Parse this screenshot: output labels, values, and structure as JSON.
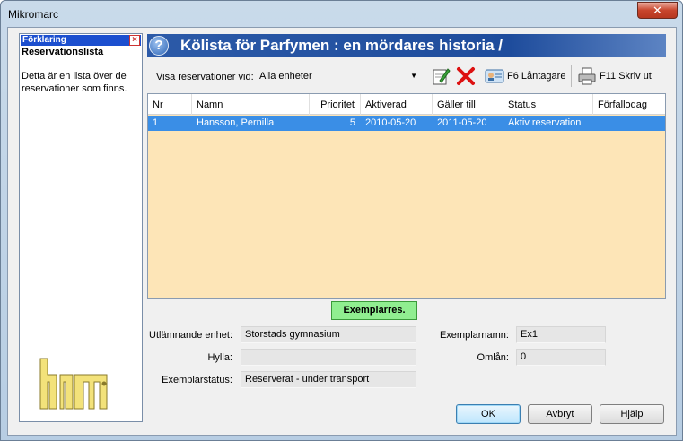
{
  "window": {
    "title": "Mikromarc",
    "close_label": "✕"
  },
  "help_panel": {
    "header": "Förklaring",
    "title": "Reservationslista",
    "text": "Detta är en lista över de reservationer som finns."
  },
  "header": {
    "title": "Kölista för Parfymen : en mördares historia /"
  },
  "toolbar": {
    "show_label": "Visa reservationer vid:",
    "unit_value": "Alla enheter",
    "borrower_label": "F6 Låntagare",
    "print_label": "F11 Skriv ut"
  },
  "table": {
    "columns": [
      "Nr",
      "Namn",
      "Prioritet",
      "Aktiverad",
      "Gäller till",
      "Status",
      "Förfallodag"
    ],
    "rows": [
      {
        "nr": "1",
        "namn": "Hansson, Pernilla",
        "prioritet": "5",
        "aktiverad": "2010-05-20",
        "galler_till": "2011-05-20",
        "status": "Aktiv reservation",
        "forfallodag": ""
      }
    ]
  },
  "exemplar_label": "Exemplarres.",
  "fields": {
    "utlamnande_label": "Utlämnande enhet:",
    "utlamnande_value": "Storstads gymnasium",
    "hylla_label": "Hylla:",
    "hylla_value": "",
    "exemplarstatus_label": "Exemplarstatus:",
    "exemplarstatus_value": "Reserverat - under transport",
    "exemplarnamn_label": "Exemplarnamn:",
    "exemplarnamn_value": "Ex1",
    "omlan_label": "Omlån:",
    "omlan_value": "0"
  },
  "buttons": {
    "ok": "OK",
    "cancel": "Avbryt",
    "help": "Hjälp"
  },
  "colors": {
    "header_blue": "#1e4c9c",
    "table_bg": "#fde5b7",
    "selected_row": "#3a8ee6",
    "exemplar_green": "#90ee90"
  }
}
